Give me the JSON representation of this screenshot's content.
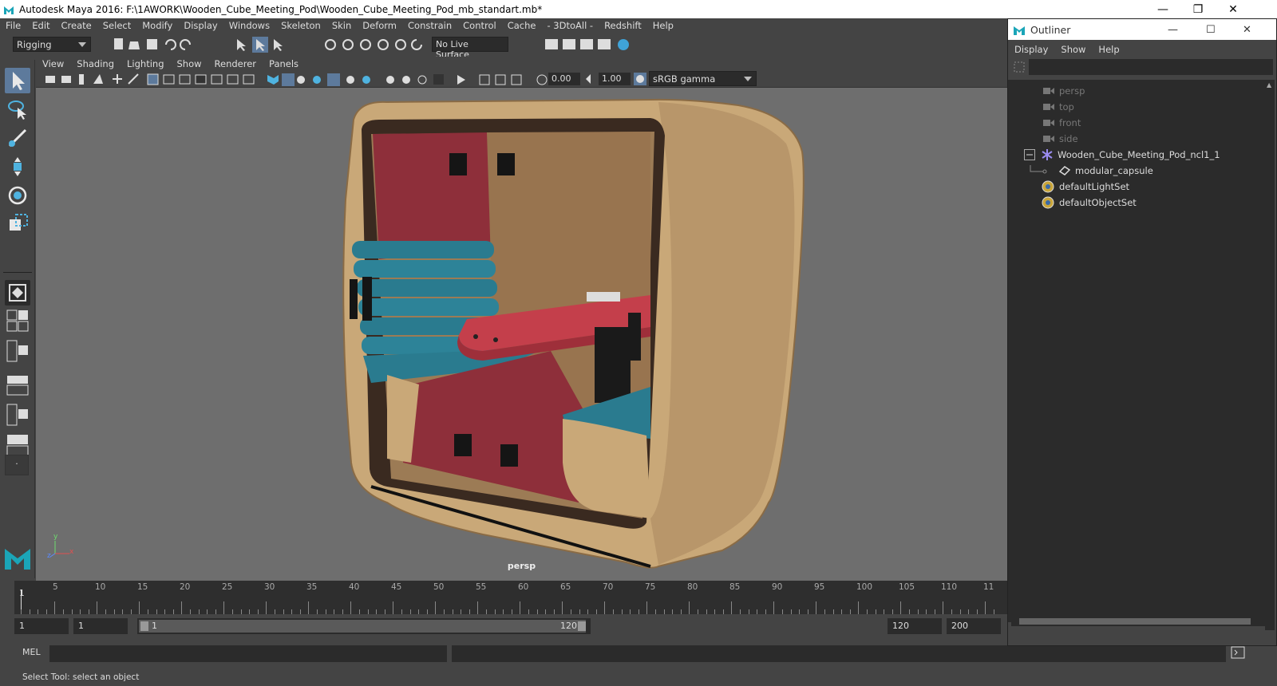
{
  "window": {
    "title": "Autodesk Maya 2016: F:\\1AWORK\\Wooden_Cube_Meeting_Pod\\Wooden_Cube_Meeting_Pod_mb_standart.mb*",
    "minimize": "—",
    "restore": "❐",
    "close": "✕"
  },
  "menu": [
    "File",
    "Edit",
    "Create",
    "Select",
    "Modify",
    "Display",
    "Windows",
    "Skeleton",
    "Skin",
    "Deform",
    "Constrain",
    "Control",
    "Cache",
    "- 3DtoAll -",
    "Redshift",
    "Help"
  ],
  "shelf": {
    "mode": "Rigging",
    "live_surface": "No Live Surface"
  },
  "panel_menu": [
    "View",
    "Shading",
    "Lighting",
    "Show",
    "Renderer",
    "Panels"
  ],
  "panel_toolbar": {
    "exposure": "0.00",
    "gamma": "1.00",
    "color_space": "sRGB gamma"
  },
  "viewport": {
    "camera_label": "persp",
    "axis_y": "y",
    "axis_x": "x",
    "axis_z": "z"
  },
  "timeline": {
    "ticks": [
      "5",
      "10",
      "15",
      "20",
      "25",
      "30",
      "35",
      "40",
      "45",
      "50",
      "55",
      "60",
      "65",
      "70",
      "75",
      "80",
      "85",
      "90",
      "95",
      "100",
      "105",
      "110",
      "11"
    ],
    "current_frame": "1"
  },
  "range": {
    "start": "1",
    "playback_start": "1",
    "slider_start": "1",
    "slider_end": "120",
    "playback_end": "120",
    "end": "200"
  },
  "command": {
    "language": "MEL"
  },
  "status": "Select Tool: select an object",
  "outliner": {
    "title": "Outliner",
    "menu": [
      "Display",
      "Show",
      "Help"
    ],
    "items": [
      {
        "label": "persp",
        "icon": "camera-icon",
        "dim": true
      },
      {
        "label": "top",
        "icon": "camera-icon",
        "dim": true
      },
      {
        "label": "front",
        "icon": "camera-icon",
        "dim": true
      },
      {
        "label": "side",
        "icon": "camera-icon",
        "dim": true
      },
      {
        "label": "Wooden_Cube_Meeting_Pod_ncl1_1",
        "icon": "asterisk-icon",
        "dim": false
      },
      {
        "label": "modular_capsule",
        "icon": "mesh-icon",
        "dim": false
      },
      {
        "label": "defaultLightSet",
        "icon": "set-icon",
        "dim": false
      },
      {
        "label": "defaultObjectSet",
        "icon": "set-icon",
        "dim": false
      }
    ]
  },
  "colors": {
    "ui_bg": "#444444",
    "viewport_bg": "#6e6e6e",
    "field_bg": "#2b2b2b",
    "selection": "#5d7a9c",
    "wood": "#c9a878",
    "cushion": "#2a7b8f",
    "red_panel": "#8e2f3a"
  }
}
